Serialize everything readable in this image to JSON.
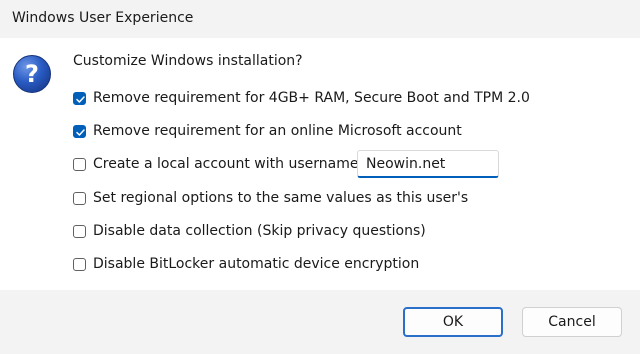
{
  "window": {
    "title": "Windows User Experience"
  },
  "dialog": {
    "icon": "question-icon",
    "prompt": "Customize Windows installation?",
    "options": [
      {
        "label": "Remove requirement for 4GB+ RAM, Secure Boot and TPM 2.0",
        "checked": true
      },
      {
        "label": "Remove requirement for an online Microsoft account",
        "checked": true
      },
      {
        "label": "Create a local account with username:",
        "checked": false
      },
      {
        "label": "Set regional options to the same values as this user's",
        "checked": false
      },
      {
        "label": "Disable data collection (Skip privacy questions)",
        "checked": false
      },
      {
        "label": "Disable BitLocker automatic device encryption",
        "checked": false
      }
    ],
    "username_value": "Neowin.net"
  },
  "buttons": {
    "ok_label": "OK",
    "cancel_label": "Cancel"
  },
  "colors": {
    "accent": "#005fb8",
    "title_bar_bg": "#f3f3f3",
    "footer_bg": "#f3f3f3",
    "icon_blue": "#1f4fb0"
  }
}
